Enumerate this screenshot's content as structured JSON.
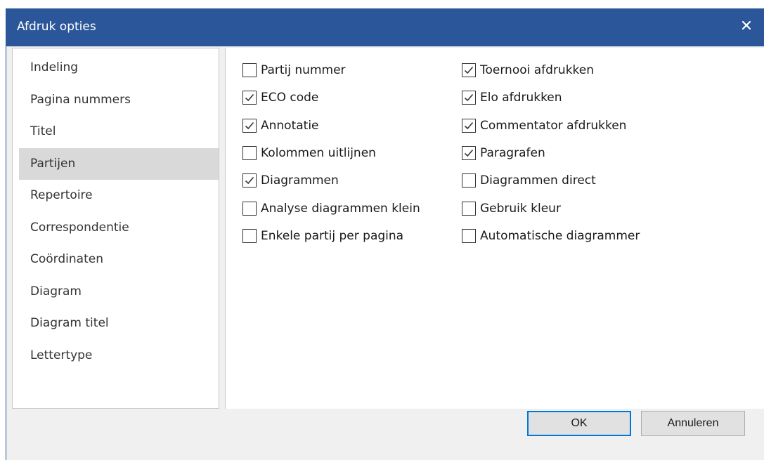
{
  "window": {
    "title": "Afdruk opties"
  },
  "nav": {
    "items": [
      {
        "label": "Indeling",
        "selected": false
      },
      {
        "label": "Pagina nummers",
        "selected": false
      },
      {
        "label": "Titel",
        "selected": false
      },
      {
        "label": "Partijen",
        "selected": true
      },
      {
        "label": "Repertoire",
        "selected": false
      },
      {
        "label": "Correspondentie",
        "selected": false
      },
      {
        "label": "Coördinaten",
        "selected": false
      },
      {
        "label": "Diagram",
        "selected": false
      },
      {
        "label": "Diagram titel",
        "selected": false
      },
      {
        "label": "Lettertype",
        "selected": false
      }
    ]
  },
  "options": {
    "left": [
      {
        "label": "Partij nummer",
        "checked": false
      },
      {
        "label": "ECO code",
        "checked": true
      },
      {
        "label": "Annotatie",
        "checked": true
      },
      {
        "label": "Kolommen uitlijnen",
        "checked": false
      },
      {
        "label": "Diagrammen",
        "checked": true
      },
      {
        "label": "Analyse diagrammen klein",
        "checked": false
      },
      {
        "label": "Enkele partij per pagina",
        "checked": false
      }
    ],
    "right": [
      {
        "label": "Toernooi afdrukken",
        "checked": true
      },
      {
        "label": "Elo afdrukken",
        "checked": true
      },
      {
        "label": "Commentator afdrukken",
        "checked": true
      },
      {
        "label": "Paragrafen",
        "checked": true
      },
      {
        "label": "Diagrammen direct",
        "checked": false
      },
      {
        "label": "Gebruik kleur",
        "checked": false
      },
      {
        "label": "Automatische diagrammer",
        "checked": false
      }
    ]
  },
  "buttons": {
    "ok": "OK",
    "cancel": "Annuleren"
  },
  "colors": {
    "titlebar": "#2b579a",
    "selected": "#d9d9d9",
    "default_button_border": "#0078d7"
  },
  "icons": {
    "close": "close-icon",
    "check": "check-icon"
  }
}
